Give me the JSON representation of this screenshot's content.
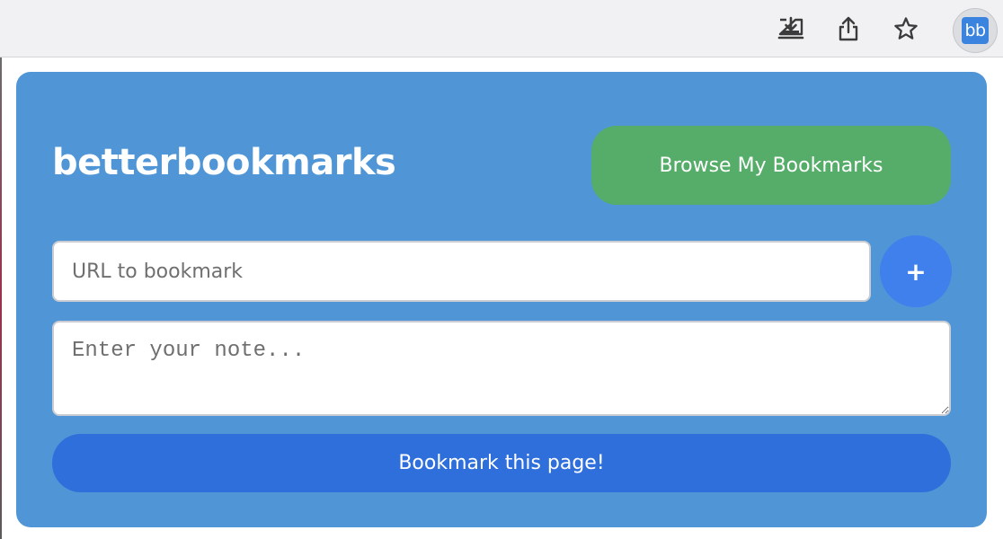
{
  "toolbar": {
    "icons": [
      "download-icon",
      "share-icon",
      "star-icon"
    ],
    "extension_badge": "bb"
  },
  "popup": {
    "brand": "betterbookmarks",
    "browse_button": "Browse My Bookmarks",
    "url_placeholder": "URL to bookmark",
    "add_button": "+",
    "note_placeholder": "Enter your note...",
    "bookmark_button": "Bookmark this page!"
  },
  "colors": {
    "card_bg": "#5096d6",
    "browse_button_bg": "#55ad69",
    "add_button_bg": "#3f80ec",
    "bookmark_button_bg": "#2f6fdb",
    "extension_badge_bg": "#3a84e0"
  }
}
